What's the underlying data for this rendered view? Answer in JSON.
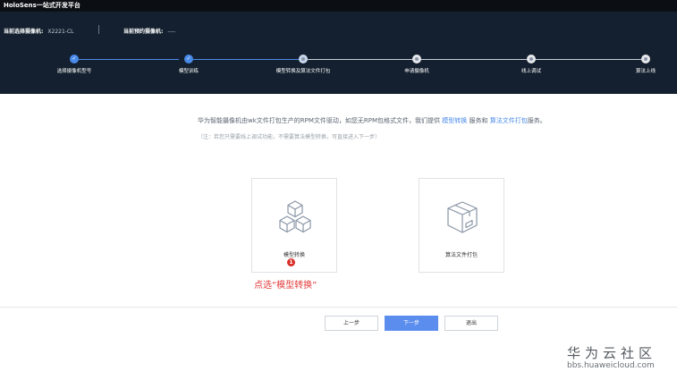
{
  "app": {
    "title": "HoloSens一站式开发平台"
  },
  "header": {
    "selected_camera_label": "当前选择摄像机:",
    "selected_camera_value": "X2221-CL",
    "reserved_camera_label": "当前预约摄像机:",
    "reserved_camera_value": "----"
  },
  "steps": [
    {
      "label": "选择摄像机型号",
      "state": "done"
    },
    {
      "label": "模型训练",
      "state": "done"
    },
    {
      "label": "模型转换及算法文件打包",
      "state": "current"
    },
    {
      "label": "申请摄像机",
      "state": "todo"
    },
    {
      "label": "线上调试",
      "state": "todo"
    },
    {
      "label": "算法上线",
      "state": "todo"
    }
  ],
  "main": {
    "intro_text": "华为智能摄像机由wk文件打包生产的RPM文件驱动，如您无RPM包格式文件，我们提供",
    "intro_link_model": "模型转换",
    "intro_and": "服务和",
    "intro_link_pack": "算法文件打包",
    "intro_end": "服务。",
    "note": "（注：若您只需要线上调试功能，不需要算法模型转换，可直接进入下一步）"
  },
  "cards": [
    {
      "label": "模型转换",
      "icon": "cubes-icon"
    },
    {
      "label": "算法文件打包",
      "icon": "package-box-icon"
    }
  ],
  "annotation": {
    "badge": "1",
    "hint": "点选“模型转换”"
  },
  "footer": {
    "prev": "上一步",
    "next": "下一步",
    "exit": "退出"
  },
  "watermark": {
    "title": "华为云社区",
    "url": "bbs.huaweicloud.com"
  },
  "colors": {
    "accent": "#4a8ae8",
    "header_bg": "#14202f",
    "annotation": "#e23a3a"
  }
}
